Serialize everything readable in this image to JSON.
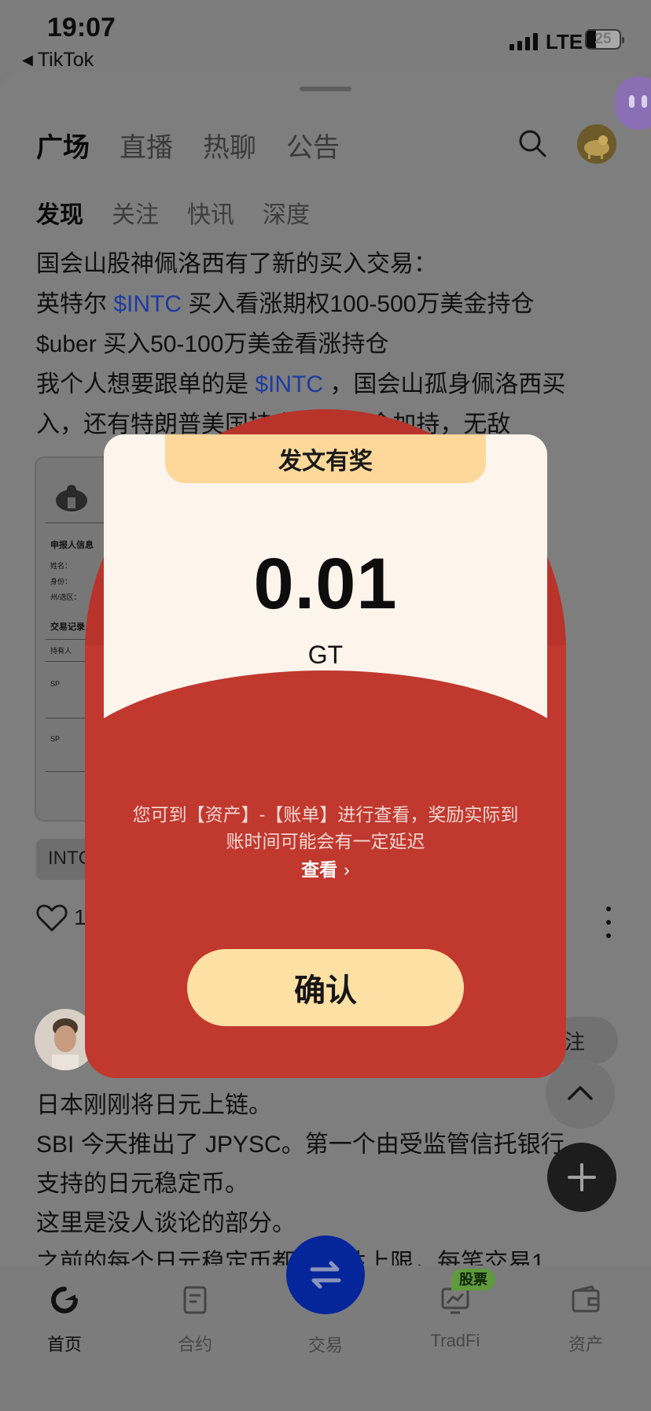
{
  "status_bar": {
    "time": "19:07",
    "back_app": "TikTok",
    "network": "LTE",
    "battery": "25"
  },
  "header": {
    "tabs": [
      "广场",
      "直播",
      "热聊",
      "公告"
    ],
    "active_tab": "广场"
  },
  "sub_tabs": [
    "发现",
    "关注",
    "快讯",
    "深度"
  ],
  "post1": {
    "line1": "国会山股神佩洛西有了新的买入交易：",
    "line2_pre": "英特尔 ",
    "line2_ticker": "$INTC",
    "line2_post": " 买入看涨期权100-500万美金持仓",
    "line3": "$uber 买入50-100万美金看涨持仓",
    "line4_pre": "我个人想要跟单的是 ",
    "line4_ticker": "$INTC",
    "line4_post": " ，国会山孤身佩洛西买",
    "line5": "入，还有特朗普美国持仓20亿美金加持，无敌",
    "image_text": {
      "section1": "申报人信息",
      "name": "姓名：",
      "role": "身份：",
      "state": "州/选区：",
      "section2": "交易记录",
      "owner_col": "持有人",
      "row1": "SP",
      "row2": "SP"
    },
    "tag": "INTC",
    "likes": "1"
  },
  "post2": {
    "follow_label": "注",
    "line1": "日本刚刚将日元上链。",
    "line2": "SBI 今天推出了 JPYSC。第一个由受监管信托银行",
    "line3": "支持的日元稳定币。",
    "line4": "这里是没人谈论的部分。",
    "line5": "之前的每个日元稳定币都有硬性上限，每笔交易1"
  },
  "bottom_nav": {
    "items": [
      {
        "label": "首页",
        "icon": "home-icon"
      },
      {
        "label": "合约",
        "icon": "contract-icon"
      },
      {
        "label": "交易",
        "icon": "swap-icon"
      },
      {
        "label": "TradFi",
        "icon": "tradfi-icon"
      },
      {
        "label": "资产",
        "icon": "wallet-icon"
      }
    ],
    "stock_badge": "股票"
  },
  "modal": {
    "banner": "发文有奖",
    "amount": "0.01",
    "unit": "GT",
    "notice_line1": "您可到【资产】-【账单】进行查看，奖励实际到",
    "notice_line2": "账时间可能会有一定延迟",
    "view_link": "查看",
    "confirm": "确认"
  },
  "colors": {
    "modal_red": "#c0382e",
    "modal_gold": "#fde0a3",
    "ticker_blue": "#1e3ba0",
    "trade_blue": "#05259b"
  }
}
